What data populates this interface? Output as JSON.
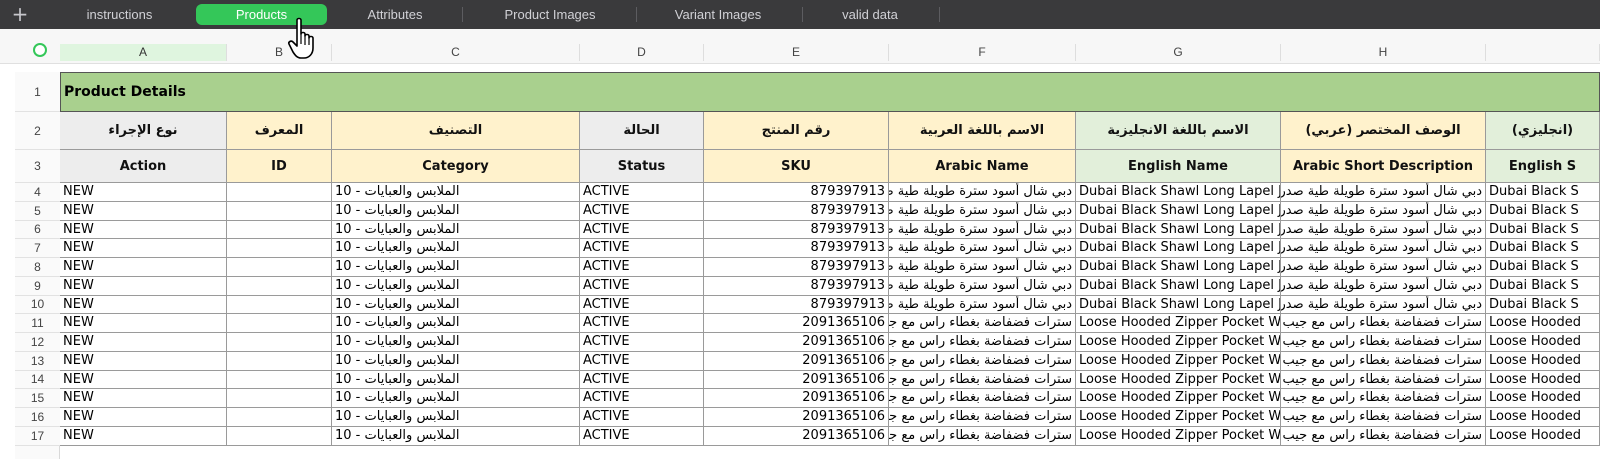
{
  "tabs": [
    {
      "label": "instructions",
      "active": false
    },
    {
      "label": "Products",
      "active": true
    },
    {
      "label": "Attributes",
      "active": false
    },
    {
      "label": "Product Images",
      "active": false
    },
    {
      "label": "Variant Images",
      "active": false
    },
    {
      "label": "valid data",
      "active": false
    }
  ],
  "add_tab_symbol": "+",
  "columns": [
    "A",
    "B",
    "C",
    "D",
    "E",
    "F",
    "G",
    "H",
    ""
  ],
  "selected_column": "A",
  "row_numbers": [
    "1",
    "2",
    "3",
    "4",
    "5",
    "6",
    "7",
    "8",
    "9",
    "10",
    "11",
    "12",
    "13",
    "14",
    "15",
    "16",
    "17"
  ],
  "section_title": "Product Details",
  "headers_arabic": [
    "نوع الإجراء",
    "المعرف",
    "التصنيف",
    "الحالة",
    "رقم المنتج",
    "الاسم باللغة العربية",
    "الاسم باللغة الانجليزية",
    "الوصف المختصر (عربي)",
    "(انجليزي)"
  ],
  "headers_english": [
    "Action",
    "ID",
    "Category",
    "Status",
    "SKU",
    "Arabic Name",
    "English Name",
    "Arabic Short Description",
    "English S"
  ],
  "rows": [
    [
      "NEW",
      "",
      "الملابس والعبايات - 10",
      "ACTIVE",
      "879397913",
      "دبي شال أسود سترة طويلة طية صدر ا",
      "Dubai Black Shawl Long Lapel Jack",
      "دبي شال أسود سترة طويلة طية صدر السترة",
      "Dubai Black S"
    ],
    [
      "NEW",
      "",
      "الملابس والعبايات - 10",
      "ACTIVE",
      "879397913",
      "دبي شال أسود سترة طويلة طية صدر ا",
      "Dubai Black Shawl Long Lapel Jack",
      "دبي شال أسود سترة طويلة طية صدر السترة",
      "Dubai Black S"
    ],
    [
      "NEW",
      "",
      "الملابس والعبايات - 10",
      "ACTIVE",
      "879397913",
      "دبي شال أسود سترة طويلة طية صدر ا",
      "Dubai Black Shawl Long Lapel Jack",
      "دبي شال أسود سترة طويلة طية صدر السترة",
      "Dubai Black S"
    ],
    [
      "NEW",
      "",
      "الملابس والعبايات - 10",
      "ACTIVE",
      "879397913",
      "دبي شال أسود سترة طويلة طية صدر ا",
      "Dubai Black Shawl Long Lapel Jack",
      "دبي شال أسود سترة طويلة طية صدر السترة",
      "Dubai Black S"
    ],
    [
      "NEW",
      "",
      "الملابس والعبايات - 10",
      "ACTIVE",
      "879397913",
      "دبي شال أسود سترة طويلة طية صدر ا",
      "Dubai Black Shawl Long Lapel Jack",
      "دبي شال أسود سترة طويلة طية صدر السترة",
      "Dubai Black S"
    ],
    [
      "NEW",
      "",
      "الملابس والعبايات - 10",
      "ACTIVE",
      "879397913",
      "دبي شال أسود سترة طويلة طية صدر ا",
      "Dubai Black Shawl Long Lapel Jack",
      "دبي شال أسود سترة طويلة طية صدر السترة",
      "Dubai Black S"
    ],
    [
      "NEW",
      "",
      "الملابس والعبايات - 10",
      "ACTIVE",
      "879397913",
      "دبي شال أسود سترة طويلة طية صدر ا",
      "Dubai Black Shawl Long Lapel Jack",
      "دبي شال أسود سترة طويلة طية صدر السترة",
      "Dubai Black S"
    ],
    [
      "NEW",
      "",
      "الملابس والعبايات - 10",
      "ACTIVE",
      "2091365106",
      "سترات فضفاضة بغطاء راس مع جيب",
      "Loose Hooded Zipper Pocket Won",
      "سترات فضفاضة بغطاء راس مع جيب بسحاب",
      "Loose Hooded"
    ],
    [
      "NEW",
      "",
      "الملابس والعبايات - 10",
      "ACTIVE",
      "2091365106",
      "سترات فضفاضة بغطاء راس مع جيب",
      "Loose Hooded Zipper Pocket Won",
      "سترات فضفاضة بغطاء راس مع جيب بسحاب",
      "Loose Hooded"
    ],
    [
      "NEW",
      "",
      "الملابس والعبايات - 10",
      "ACTIVE",
      "2091365106",
      "سترات فضفاضة بغطاء راس مع جيب",
      "Loose Hooded Zipper Pocket Won",
      "سترات فضفاضة بغطاء راس مع جيب بسحاب",
      "Loose Hooded"
    ],
    [
      "NEW",
      "",
      "الملابس والعبايات - 10",
      "ACTIVE",
      "2091365106",
      "سترات فضفاضة بغطاء راس مع جيب",
      "Loose Hooded Zipper Pocket Won",
      "سترات فضفاضة بغطاء راس مع جيب بسحاب",
      "Loose Hooded"
    ],
    [
      "NEW",
      "",
      "الملابس والعبايات - 10",
      "ACTIVE",
      "2091365106",
      "سترات فضفاضة بغطاء راس مع جيب",
      "Loose Hooded Zipper Pocket Won",
      "سترات فضفاضة بغطاء راس مع جيب بسحاب",
      "Loose Hooded"
    ],
    [
      "NEW",
      "",
      "الملابس والعبايات - 10",
      "ACTIVE",
      "2091365106",
      "سترات فضفاضة بغطاء راس مع جيب",
      "Loose Hooded Zipper Pocket Won",
      "سترات فضفاضة بغطاء راس مع جيب بسحاب",
      "Loose Hooded"
    ],
    [
      "NEW",
      "",
      "الملابس والعبايات - 10",
      "ACTIVE",
      "2091365106",
      "سترات فضفاضة بغطاء راس مع جيب",
      "Loose Hooded Zipper Pocket Won",
      "سترات فضفاضة بغطاء راس مع جيب بسحاب",
      "Loose Hooded"
    ]
  ],
  "colors": {
    "active_tab": "#34c759",
    "title_fill": "#a9d08e",
    "header_grey": "#ededed",
    "header_yellow": "#fff2cc",
    "header_green": "#e2efda"
  }
}
